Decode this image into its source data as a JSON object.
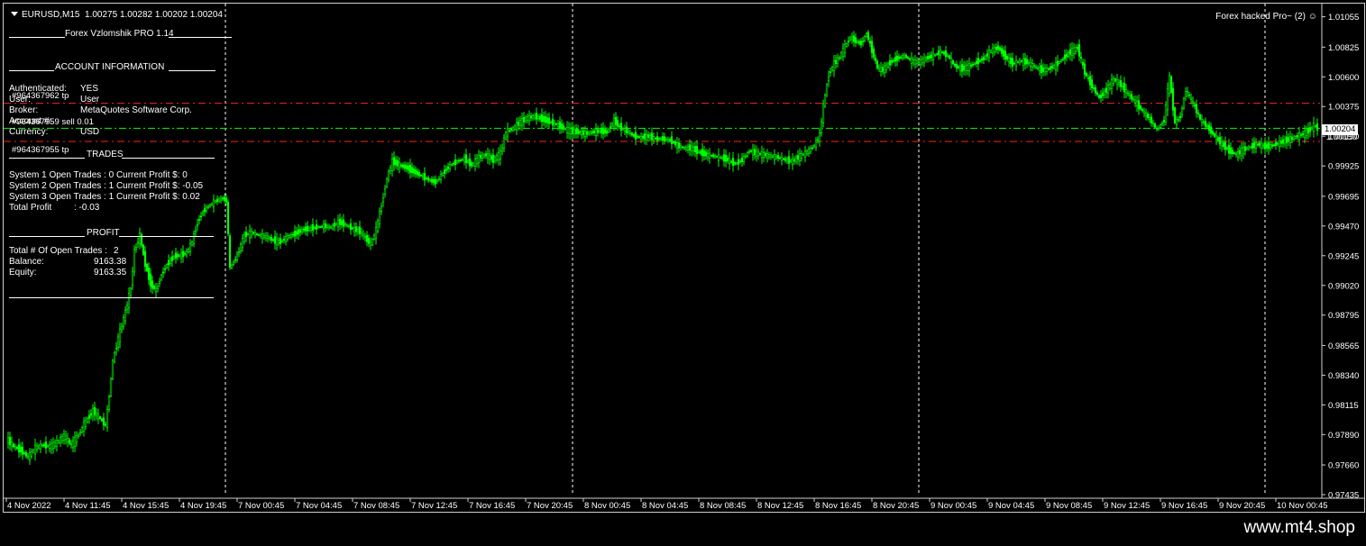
{
  "header": {
    "symbol_tf": "EURUSD,M15",
    "ohlc": "1.00275 1.00282 1.00202 1.00204"
  },
  "ea_label": "Forex hacked Pro~ (2)",
  "smiley_icon": "smiley-face",
  "panel": {
    "title": "Forex Vzlomshik PRO 1.14",
    "account_header": "ACCOUNT INFORMATION",
    "authenticated_label": "Authenticated:",
    "authenticated_value": "YES",
    "user_label": "User:",
    "user_value": "User",
    "broker_label": "Broker:",
    "broker_value": "MetaQuotes Software Corp.",
    "account_label": "Account #:",
    "account_value": "",
    "currency_label": "Currency:",
    "currency_value": "USD",
    "trades_header": "TRADES",
    "sys1": "System 1 Open Trades :  0   Current Profit $:  0",
    "sys2": "System 2 Open Trades :  1   Current Profit $:  -0.05",
    "sys3": "System 3 Open Trades :  1   Current Profit $:  0.02",
    "total_profit_label": "Total Profit",
    "total_profit_value": ":  -0.03",
    "profit_header": "PROFIT",
    "open_trades_label": "Total # Of Open Trades :",
    "open_trades_value": "2",
    "balance_label": "Balance:",
    "balance_value": "9163.38",
    "equity_label": "Equity:",
    "equity_value": "9163.35"
  },
  "overlays": {
    "tp1": "#964367962 tp",
    "sl_line": "#964367959 sell 0.01",
    "tp2": "#964367955 tp",
    "right_partial": "1.00150"
  },
  "brand": "www.mt4.shop",
  "colors": {
    "background": "#000000",
    "candle": "#00ff00",
    "grid_vline": "#ffffff",
    "order_line": "#ff2020",
    "entry_line": "#00ff00"
  },
  "chart_data": {
    "type": "candlestick",
    "symbol": "EURUSD",
    "timeframe": "M15",
    "ylim": [
      0.97435,
      1.011
    ],
    "y_ticks": [
      "1.01055",
      "1.00825",
      "1.00600",
      "1.00375",
      "1.00150",
      "0.99925",
      "0.99695",
      "0.99470",
      "0.99245",
      "0.99020",
      "0.98795",
      "0.98565",
      "0.98340",
      "0.98115",
      "0.97890",
      "0.97660",
      "0.97435"
    ],
    "x_ticks": [
      "4 Nov 2022",
      "4 Nov 11:45",
      "4 Nov 15:45",
      "4 Nov 19:45",
      "7 Nov 00:45",
      "7 Nov 04:45",
      "7 Nov 08:45",
      "7 Nov 12:45",
      "7 Nov 16:45",
      "7 Nov 20:45",
      "8 Nov 00:45",
      "8 Nov 04:45",
      "8 Nov 08:45",
      "8 Nov 12:45",
      "8 Nov 16:45",
      "8 Nov 20:45",
      "9 Nov 00:45",
      "9 Nov 04:45",
      "9 Nov 08:45",
      "9 Nov 12:45",
      "9 Nov 16:45",
      "9 Nov 20:45",
      "10 Nov 00:45"
    ],
    "current_price": 1.00204,
    "current_price_label": "1.00204",
    "horizontal_lines": [
      {
        "kind": "tp",
        "price": 1.004
      },
      {
        "kind": "entry",
        "price": 1.0021
      },
      {
        "kind": "tp",
        "price": 1.0011
      }
    ],
    "series": [
      {
        "values": [
          [
            0,
            0.9786
          ],
          [
            8,
            0.978
          ],
          [
            16,
            0.9777
          ],
          [
            24,
            0.9772
          ],
          [
            32,
            0.9779
          ],
          [
            40,
            0.9781
          ],
          [
            48,
            0.978
          ],
          [
            56,
            0.9783
          ],
          [
            64,
            0.9788
          ],
          [
            72,
            0.9781
          ],
          [
            80,
            0.9789
          ],
          [
            88,
            0.9799
          ],
          [
            96,
            0.9807
          ],
          [
            104,
            0.9801
          ],
          [
            110,
            0.9796
          ],
          [
            114,
            0.9818
          ],
          [
            118,
            0.9845
          ],
          [
            124,
            0.9862
          ],
          [
            132,
            0.9882
          ],
          [
            138,
            0.99
          ],
          [
            142,
            0.9928
          ],
          [
            148,
            0.994
          ],
          [
            154,
            0.9918
          ],
          [
            160,
            0.9903
          ],
          [
            166,
            0.9898
          ],
          [
            172,
            0.991
          ],
          [
            178,
            0.9918
          ],
          [
            186,
            0.9924
          ],
          [
            194,
            0.9925
          ],
          [
            200,
            0.9927
          ],
          [
            206,
            0.9935
          ],
          [
            212,
            0.995
          ],
          [
            218,
            0.9958
          ],
          [
            224,
            0.9962
          ],
          [
            232,
            0.9966
          ],
          [
            240,
            0.9968
          ],
          [
            244,
            0.9966
          ],
          [
            248,
            0.9915
          ],
          [
            256,
            0.9925
          ],
          [
            264,
            0.994
          ],
          [
            272,
            0.9942
          ],
          [
            280,
            0.994
          ],
          [
            288,
            0.9939
          ],
          [
            296,
            0.9936
          ],
          [
            304,
            0.9935
          ],
          [
            312,
            0.9939
          ],
          [
            320,
            0.9941
          ],
          [
            328,
            0.9944
          ],
          [
            336,
            0.9945
          ],
          [
            344,
            0.9946
          ],
          [
            352,
            0.9947
          ],
          [
            360,
            0.9946
          ],
          [
            368,
            0.995
          ],
          [
            376,
            0.9948
          ],
          [
            384,
            0.9945
          ],
          [
            392,
            0.9943
          ],
          [
            398,
            0.9938
          ],
          [
            404,
            0.9933
          ],
          [
            410,
            0.9944
          ],
          [
            416,
            0.9963
          ],
          [
            422,
            0.9983
          ],
          [
            428,
            0.9996
          ],
          [
            436,
            0.9993
          ],
          [
            444,
            0.9991
          ],
          [
            452,
            0.9988
          ],
          [
            460,
            0.9985
          ],
          [
            468,
            0.9982
          ],
          [
            476,
            0.998
          ],
          [
            484,
            0.9987
          ],
          [
            492,
            0.9993
          ],
          [
            500,
            0.9996
          ],
          [
            508,
            0.9998
          ],
          [
            516,
            0.9993
          ],
          [
            524,
            0.9999
          ],
          [
            532,
            1.0001
          ],
          [
            540,
            0.9997
          ],
          [
            548,
            1.0002
          ],
          [
            554,
            1.0018
          ],
          [
            562,
            1.0021
          ],
          [
            570,
            1.0026
          ],
          [
            578,
            1.0029
          ],
          [
            586,
            1.003
          ],
          [
            594,
            1.0028
          ],
          [
            602,
            1.0026
          ],
          [
            610,
            1.0024
          ],
          [
            618,
            1.0021
          ],
          [
            626,
            1.0019
          ],
          [
            634,
            1.0018
          ],
          [
            642,
            1.0017
          ],
          [
            650,
            1.0018
          ],
          [
            658,
            1.0019
          ],
          [
            666,
            1.0018
          ],
          [
            674,
            1.0027
          ],
          [
            680,
            1.0022
          ],
          [
            688,
            1.0019
          ],
          [
            696,
            1.0015
          ],
          [
            704,
            1.0014
          ],
          [
            712,
            1.0015
          ],
          [
            720,
            1.0013
          ],
          [
            728,
            1.0013
          ],
          [
            736,
            1.0012
          ],
          [
            744,
            1.0008
          ],
          [
            752,
            1.0006
          ],
          [
            760,
            1.0006
          ],
          [
            768,
            1.0003
          ],
          [
            776,
            1.0001
          ],
          [
            784,
            1.0
          ],
          [
            792,
            0.9999
          ],
          [
            800,
            0.9997
          ],
          [
            808,
            0.9994
          ],
          [
            816,
            0.9997
          ],
          [
            824,
            1.0004
          ],
          [
            832,
            1.0002
          ],
          [
            840,
            1.0001
          ],
          [
            848,
            1.0
          ],
          [
            856,
            0.9999
          ],
          [
            864,
            0.9997
          ],
          [
            872,
            0.9996
          ],
          [
            880,
            1.0
          ],
          [
            888,
            1.0003
          ],
          [
            896,
            1.0008
          ],
          [
            902,
            1.0016
          ],
          [
            906,
            1.0038
          ],
          [
            912,
            1.0062
          ],
          [
            918,
            1.007
          ],
          [
            924,
            1.0075
          ],
          [
            930,
            1.0083
          ],
          [
            936,
            1.009
          ],
          [
            942,
            1.0087
          ],
          [
            948,
            1.0085
          ],
          [
            954,
            1.0093
          ],
          [
            960,
            1.008
          ],
          [
            966,
            1.0067
          ],
          [
            972,
            1.0065
          ],
          [
            980,
            1.0071
          ],
          [
            988,
            1.0074
          ],
          [
            996,
            1.0076
          ],
          [
            1004,
            1.0072
          ],
          [
            1012,
            1.0071
          ],
          [
            1020,
            1.0074
          ],
          [
            1028,
            1.0076
          ],
          [
            1036,
            1.0079
          ],
          [
            1044,
            1.0076
          ],
          [
            1052,
            1.0068
          ],
          [
            1060,
            1.0066
          ],
          [
            1068,
            1.0068
          ],
          [
            1076,
            1.0071
          ],
          [
            1084,
            1.0074
          ],
          [
            1092,
            1.008
          ],
          [
            1100,
            1.0082
          ],
          [
            1108,
            1.0075
          ],
          [
            1116,
            1.007
          ],
          [
            1124,
            1.0072
          ],
          [
            1132,
            1.0071
          ],
          [
            1140,
            1.0068
          ],
          [
            1148,
            1.0065
          ],
          [
            1156,
            1.0066
          ],
          [
            1164,
            1.0069
          ],
          [
            1172,
            1.0074
          ],
          [
            1180,
            1.0079
          ],
          [
            1188,
            1.0082
          ],
          [
            1196,
            1.0063
          ],
          [
            1204,
            1.0053
          ],
          [
            1212,
            1.0044
          ],
          [
            1220,
            1.005
          ],
          [
            1228,
            1.0058
          ],
          [
            1236,
            1.0054
          ],
          [
            1244,
            1.0047
          ],
          [
            1252,
            1.0041
          ],
          [
            1260,
            1.0034
          ],
          [
            1268,
            1.0028
          ],
          [
            1276,
            1.002
          ],
          [
            1284,
            1.0027
          ],
          [
            1290,
            1.006
          ],
          [
            1296,
            1.0025
          ],
          [
            1302,
            1.003
          ],
          [
            1308,
            1.005
          ],
          [
            1316,
            1.004
          ],
          [
            1324,
            1.0028
          ],
          [
            1332,
            1.0022
          ],
          [
            1340,
            1.0015
          ],
          [
            1348,
            1.0009
          ],
          [
            1356,
            1.0004
          ],
          [
            1364,
            1.0001
          ],
          [
            1372,
            1.0005
          ],
          [
            1380,
            1.0007
          ],
          [
            1388,
            1.0009
          ],
          [
            1396,
            1.0007
          ],
          [
            1404,
            1.0008
          ],
          [
            1412,
            1.001
          ],
          [
            1420,
            1.0012
          ],
          [
            1428,
            1.0014
          ],
          [
            1436,
            1.0016
          ],
          [
            1444,
            1.0019
          ],
          [
            1450,
            1.0023
          ],
          [
            1456,
            1.002
          ]
        ]
      }
    ]
  }
}
